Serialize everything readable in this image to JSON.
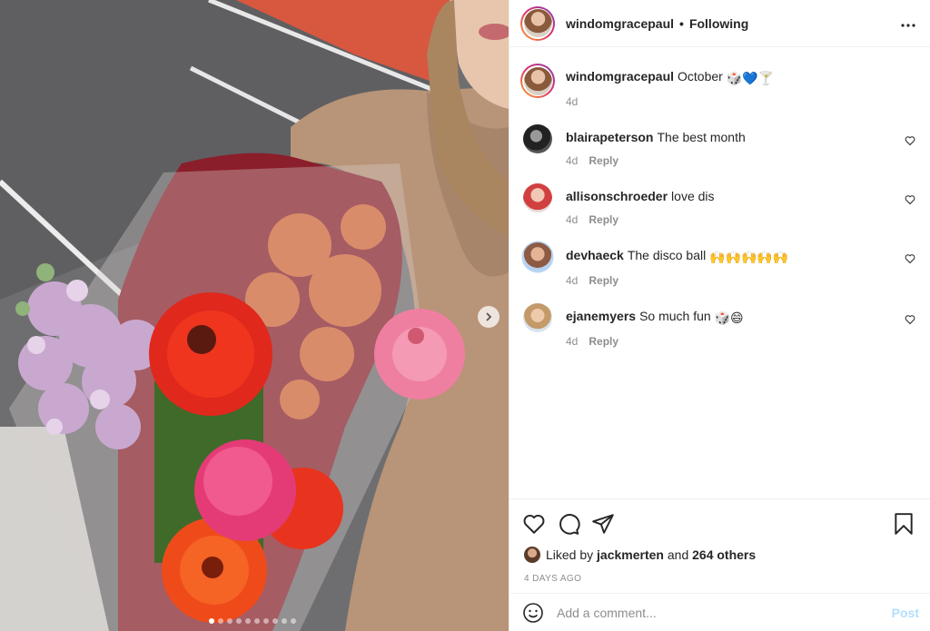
{
  "header": {
    "username": "windomgracepaul",
    "separator": "•",
    "follow_status": "Following",
    "more_label": "•••"
  },
  "caption": {
    "username": "windomgracepaul",
    "text": "October",
    "emojis": "🎲💙🍸",
    "time": "4d"
  },
  "comments": [
    {
      "username": "blairapeterson",
      "text": "The best month",
      "time": "4d",
      "reply": "Reply"
    },
    {
      "username": "allisonschroeder",
      "text": "love dis",
      "time": "4d",
      "reply": "Reply"
    },
    {
      "username": "devhaeck",
      "text": "The disco ball",
      "emojis": "🙌🙌🙌🙌🙌",
      "time": "4d",
      "reply": "Reply"
    },
    {
      "username": "ejanemyers",
      "text": "So much fun",
      "emojis": "🎲😄",
      "time": "4d",
      "reply": "Reply"
    }
  ],
  "likes": {
    "prefix": "Liked by",
    "user": "jackmerten",
    "and": "and",
    "others": "264 others"
  },
  "date": "4 DAYS AGO",
  "comment_box": {
    "placeholder": "Add a comment...",
    "post_label": "Post"
  },
  "carousel": {
    "count": 10,
    "active_index": 0
  },
  "colors": {
    "accent_post_disabled": "#b2dffc",
    "secondary_text": "#8e8e8e",
    "border": "#efefef"
  },
  "icons": {
    "more": "ellipsis-icon",
    "like": "heart-icon",
    "comment": "comment-bubble-icon",
    "share": "paper-plane-icon",
    "save": "bookmark-icon",
    "emoji": "smiley-icon",
    "next": "chevron-right-icon"
  }
}
